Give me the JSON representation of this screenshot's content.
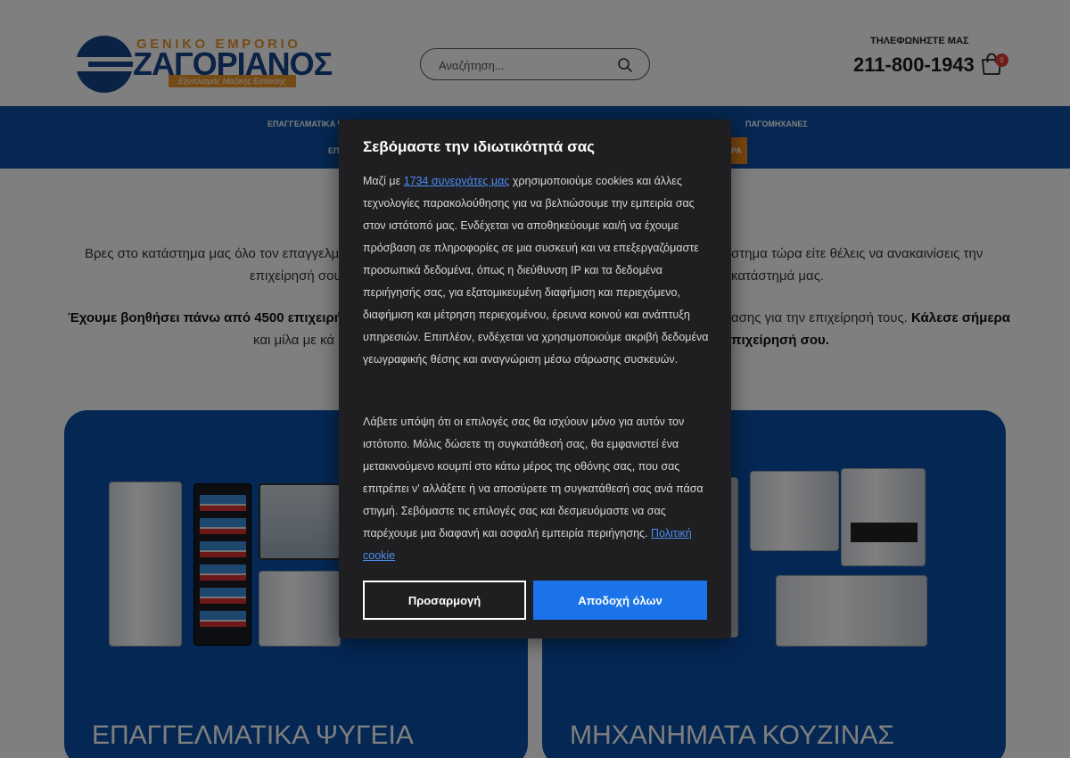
{
  "header": {
    "logo": {
      "top_text": "GENIKO EMPORIO",
      "brand": "ZΑΓΟΡΙΑΝΟΣ",
      "tagline": "Εξοπλισμός Μαζικής Εστίασης"
    },
    "search": {
      "placeholder": "Αναζήτηση..."
    },
    "call_label": "ΤΗΛΕΦΩΝΗΣΤΕ ΜΑΣ",
    "phone": "211-800-1943",
    "cart_count": "0"
  },
  "nav": {
    "items": [
      "ΕΠΑΓΓΕΛΜΑΤΙΚΑ Ψ",
      "ΠΑΓΟΜΗΧΑΝΕΣ",
      "ΕΠ"
    ],
    "cta": "ΡΑ"
  },
  "intro": {
    "line1_left": "Βρες στο κατάστημα μας όλο τον επαγγελμ",
    "line1_right": "στημα τώρα είτε θέλεις να ανακαινίσεις την",
    "line2_left": "επιχείρησή σου",
    "line2_right": "κατάστημά μας.",
    "line3_left": "Έχουμε βοηθήσει πάνω από 4500 επιχειρήσε",
    "line3_right_plain": "ασης για την επιχείρησή τους.",
    "line3_right_bold": "Κάλεσε σήμερα",
    "line4_left": "και μίλα με κά",
    "line4_right": "πιχείρησή σου."
  },
  "cards": [
    {
      "title": "ΕΠΑΓΓΕΛΜΑΤΙΚΑ ΨΥΓΕΙΑ"
    },
    {
      "title": "ΜΗΧΑΝΗΜΑΤΑ ΚΟΥΖΙΝΑΣ"
    }
  ],
  "cookie_modal": {
    "title": "Σεβόμαστε την ιδιωτικότητά σας",
    "p1_before": "Μαζί με ",
    "p1_link": "1734 συνεργάτες μας",
    "p1_after": " χρησιμοποιούμε cookies και άλλες τεχνολογίες παρακολούθησης για να βελτιώσουμε την εμπειρία σας στον ιστότοπό μας. Ενδέχεται να αποθηκεύουμε και/ή να έχουμε πρόσβαση σε πληροφορίες σε μια συσκευή και να επεξεργαζόμαστε προσωπικά δεδομένα, όπως η διεύθυνση IP και τα δεδομένα περιήγησής σας, για εξατομικευμένη διαφήμιση και περιεχόμενο, διαφήμιση και μέτρηση περιεχομένου, έρευνα κοινού και ανάπτυξη υπηρεσιών. Επιπλέον, ενδέχεται να χρησιμοποιούμε ακριβή δεδομένα γεωγραφικής θέσης και αναγνώριση μέσω σάρωσης συσκευών.",
    "p2_text": "Λάβετε υπόψη ότι οι επιλογές σας θα ισχύουν μόνο για αυτόν τον ιστότοπο. Μόλις δώσετε τη συγκατάθεσή σας, θα εμφανιστεί ένα μετακινούμενο κουμπί στο κάτω μέρος της οθόνης σας, που σας επιτρέπει ν' αλλάξετε ή να αποσύρετε τη συγκατάθεσή σας ανά πάσα στιγμή. Σεβόμαστε τις επιλογές σας και δεσμευόμαστε να σας παρέχουμε μια διαφανή και ασφαλή εμπειρία περιήγησης. ",
    "p2_link": "Πολιτική cookie",
    "customize_label": "Προσαρμογή",
    "accept_label": "Αποδοχή όλων"
  },
  "colors": {
    "brand_blue": "#0b4ea2",
    "accent_orange": "#f08a1c",
    "accept_blue": "#1a73e8",
    "modal_bg": "#1f1f21",
    "badge_red": "#e53935"
  }
}
